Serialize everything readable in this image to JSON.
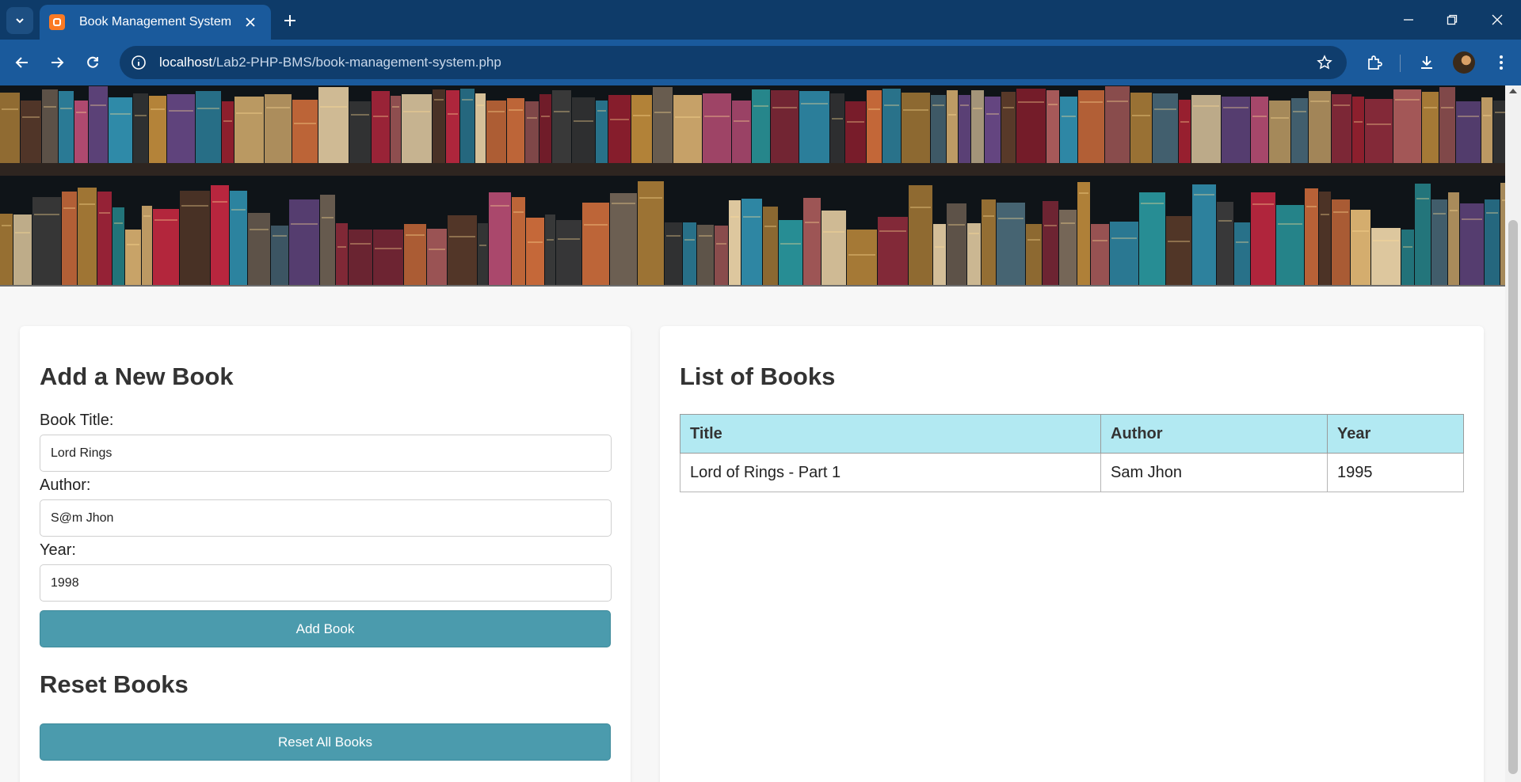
{
  "browser": {
    "tab_title": "Book Management System",
    "url_host": "localhost",
    "url_path": "/Lab2-PHP-BMS/book-management-system.php"
  },
  "form": {
    "heading": "Add a New Book",
    "title_label": "Book Title:",
    "title_value": "Lord Rings",
    "author_label": "Author:",
    "author_value": "S@m Jhon",
    "year_label": "Year:",
    "year_value": "1998",
    "submit_label": "Add Book"
  },
  "reset": {
    "heading": "Reset Books",
    "button_label": "Reset All Books"
  },
  "list": {
    "heading": "List of Books",
    "columns": [
      "Title",
      "Author",
      "Year"
    ],
    "rows": [
      {
        "title": "Lord of Rings - Part 1",
        "author": "Sam Jhon",
        "year": "1995"
      }
    ]
  },
  "colors": {
    "button": "#4b9bad",
    "table_header": "#b2e9f2",
    "chrome": "#1a5a9c"
  }
}
